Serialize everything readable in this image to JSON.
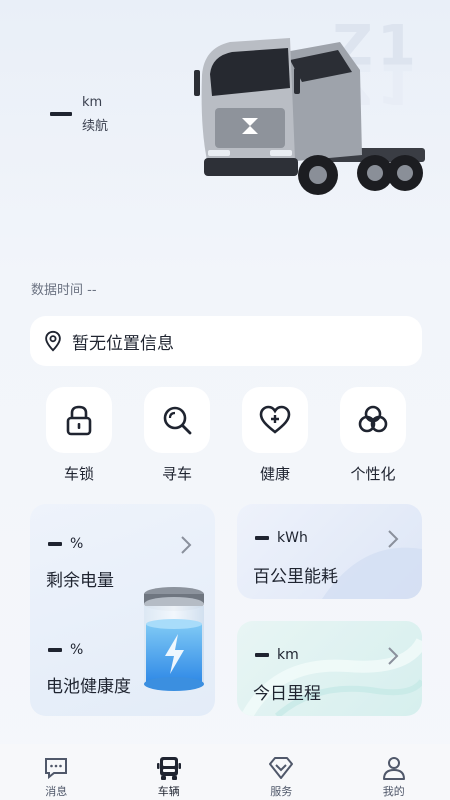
{
  "hero": {
    "brand_mark": "Z1",
    "range_unit": "km",
    "range_label": "续航"
  },
  "data_time": "数据时间 --",
  "location": {
    "text": "暂无位置信息"
  },
  "quick_actions": [
    {
      "label": "车锁",
      "icon": "lock-icon"
    },
    {
      "label": "寻车",
      "icon": "search-icon"
    },
    {
      "label": "健康",
      "icon": "heart-plus-icon"
    },
    {
      "label": "个性化",
      "icon": "circles-icon"
    }
  ],
  "cards": {
    "battery_remaining": {
      "unit": "%",
      "label": "剩余电量"
    },
    "battery_health": {
      "unit": "%",
      "label": "电池健康度"
    },
    "energy_per_100km": {
      "unit": "kWh",
      "label": "百公里能耗"
    },
    "today_mileage": {
      "unit": "km",
      "label": "今日里程"
    }
  },
  "tabs": [
    {
      "label": "消息",
      "icon": "message-icon",
      "active": false
    },
    {
      "label": "车辆",
      "icon": "truck-icon",
      "active": true
    },
    {
      "label": "服务",
      "icon": "diamond-icon",
      "active": false
    },
    {
      "label": "我的",
      "icon": "profile-icon",
      "active": false
    }
  ]
}
